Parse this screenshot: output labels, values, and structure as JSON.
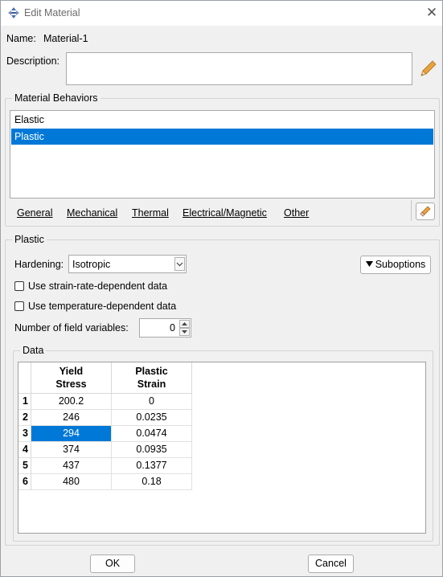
{
  "window": {
    "title": "Edit Material"
  },
  "name": {
    "label": "Name:",
    "value": "Material-1"
  },
  "description": {
    "label": "Description:",
    "value": ""
  },
  "behaviors": {
    "title": "Material Behaviors",
    "items": [
      {
        "label": "Elastic",
        "selected": false
      },
      {
        "label": "Plastic",
        "selected": true
      }
    ],
    "menus": [
      "General",
      "Mechanical",
      "Thermal",
      "Electrical/Magnetic",
      "Other"
    ]
  },
  "plastic": {
    "title": "Plastic",
    "hardening_label": "Hardening:",
    "hardening_value": "Isotropic",
    "suboptions_label": "Suboptions",
    "strain_rate_label": "Use strain-rate-dependent data",
    "strain_rate_checked": false,
    "temperature_label": "Use temperature-dependent data",
    "temperature_checked": false,
    "field_vars_label": "Number of field variables:",
    "field_vars_value": "0"
  },
  "data": {
    "title": "Data",
    "columns": [
      {
        "line1": "Yield",
        "line2": "Stress"
      },
      {
        "line1": "Plastic",
        "line2": "Strain"
      }
    ],
    "rows": [
      {
        "n": "1",
        "stress": "200.2",
        "strain": "0"
      },
      {
        "n": "2",
        "stress": "246",
        "strain": "0.0235"
      },
      {
        "n": "3",
        "stress": "294",
        "strain": "0.0474"
      },
      {
        "n": "4",
        "stress": "374",
        "strain": "0.0935"
      },
      {
        "n": "5",
        "stress": "437",
        "strain": "0.1377"
      },
      {
        "n": "6",
        "stress": "480",
        "strain": "0.18"
      }
    ],
    "selected_row": 3
  },
  "buttons": {
    "ok": "OK",
    "cancel": "Cancel"
  },
  "colors": {
    "selection": "#0078d7",
    "background": "#f0f0f0",
    "edit_icon": "#e8a33d"
  },
  "icons": [
    "app-icon",
    "close-icon",
    "pencil-icon",
    "eraser-icon",
    "triangle-down-icon",
    "chevron-down-icon",
    "spin-up-icon",
    "spin-down-icon"
  ]
}
